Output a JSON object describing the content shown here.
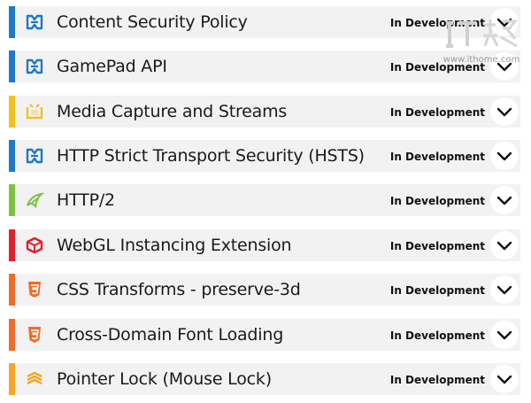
{
  "features": [
    {
      "name": "Content Security Policy",
      "status": "In Development",
      "icon": "w3c-icon",
      "accent": "#1e78c8"
    },
    {
      "name": "GamePad API",
      "status": "In Development",
      "icon": "w3c-icon",
      "accent": "#1e78c8"
    },
    {
      "name": "Media Capture and Streams",
      "status": "In Development",
      "icon": "media-capture-icon",
      "accent": "#f2c21a"
    },
    {
      "name": "HTTP Strict Transport Security (HSTS)",
      "status": "In Development",
      "icon": "w3c-icon",
      "accent": "#1e78c8"
    },
    {
      "name": "HTTP/2",
      "status": "In Development",
      "icon": "http2-icon",
      "accent": "#7cc142"
    },
    {
      "name": "WebGL Instancing Extension",
      "status": "In Development",
      "icon": "webgl-icon",
      "accent": "#e0202d"
    },
    {
      "name": "CSS Transforms - preserve-3d",
      "status": "In Development",
      "icon": "css3-icon",
      "accent": "#ee6d2a"
    },
    {
      "name": "Cross-Domain Font Loading",
      "status": "In Development",
      "icon": "css3-icon",
      "accent": "#ee6d2a"
    },
    {
      "name": "Pointer Lock (Mouse Lock)",
      "status": "In Development",
      "icon": "stack-icon",
      "accent": "#f5a623"
    }
  ],
  "watermark": {
    "url": "www.ithome.com",
    "logo_text": "IT之家"
  }
}
